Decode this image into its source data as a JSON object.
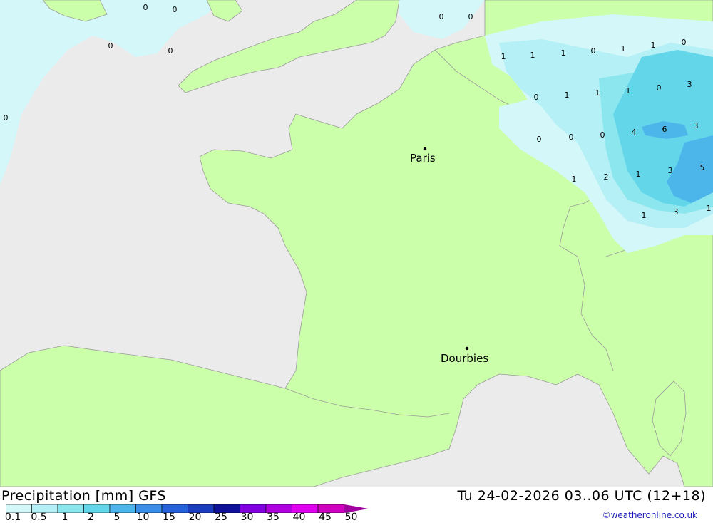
{
  "map": {
    "cities": [
      {
        "name": "Paris"
      },
      {
        "name": "Dourbies"
      }
    ],
    "values": [
      "0",
      "0",
      "0",
      "0",
      "0",
      "0",
      "0",
      "1",
      "1",
      "1",
      "0",
      "1",
      "1",
      "0",
      "0",
      "1",
      "1",
      "1",
      "0",
      "3",
      "0",
      "0",
      "0",
      "4",
      "6",
      "3",
      "1",
      "2",
      "1",
      "3",
      "5",
      "1",
      "3",
      "1"
    ]
  },
  "footer": {
    "title": "Precipitation [mm] GFS",
    "datetime": "Tu 24-02-2026 03..06 UTC (12+18)",
    "credit": "©weatheronline.co.uk",
    "scale_labels": [
      "0.1",
      "0.5",
      "1",
      "2",
      "5",
      "10",
      "15",
      "20",
      "25",
      "30",
      "35",
      "40",
      "45",
      "50"
    ],
    "scale_colors": [
      "#d4f7fa",
      "#b4f0f5",
      "#8ce6ee",
      "#64d6ea",
      "#4cb6ea",
      "#3a8ee8",
      "#2860dc",
      "#1c3cc0",
      "#10109a",
      "#8000e0",
      "#b000e0",
      "#e000f0",
      "#d000c0",
      "#a000a0"
    ]
  }
}
